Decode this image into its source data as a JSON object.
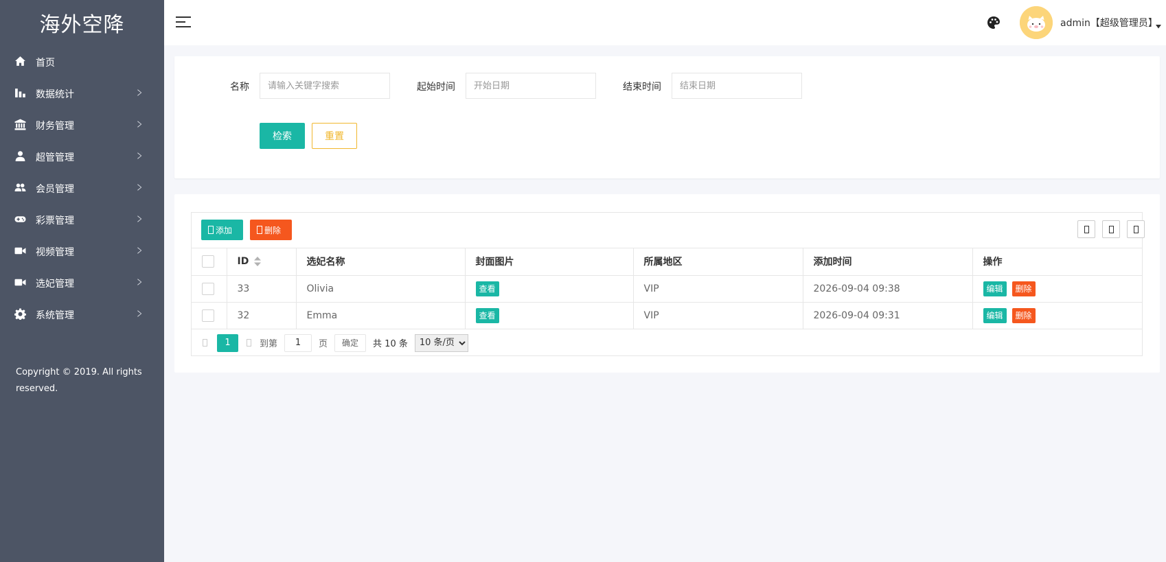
{
  "sidebar": {
    "logo": "海外空降",
    "items": [
      {
        "label": "首页",
        "icon": "home-icon",
        "has_arrow": false
      },
      {
        "label": "数据统计",
        "icon": "bar-chart-icon",
        "has_arrow": true
      },
      {
        "label": "财务管理",
        "icon": "bank-icon",
        "has_arrow": true
      },
      {
        "label": "超管管理",
        "icon": "user-icon",
        "has_arrow": true
      },
      {
        "label": "会员管理",
        "icon": "users-icon",
        "has_arrow": true
      },
      {
        "label": "彩票管理",
        "icon": "gamepad-icon",
        "has_arrow": true
      },
      {
        "label": "视频管理",
        "icon": "video-camera-icon",
        "has_arrow": true
      },
      {
        "label": "选妃管理",
        "icon": "video-camera-icon",
        "has_arrow": true
      },
      {
        "label": "系统管理",
        "icon": "gear-icon",
        "has_arrow": true
      }
    ],
    "copyright": "Copyright © 2019. All rights reserved."
  },
  "header": {
    "user_label": "admin【超级管理员】"
  },
  "search": {
    "name_label": "名称",
    "name_placeholder": "请输入关键字搜索",
    "start_label": "起始时间",
    "start_placeholder": "开始日期",
    "end_label": "结束时间",
    "end_placeholder": "结束日期",
    "search_button": "检索",
    "reset_button": "重置"
  },
  "toolbar": {
    "add_label": "添加",
    "delete_label": "删除"
  },
  "table": {
    "columns": [
      "ID",
      "选妃名称",
      "封面图片",
      "所属地区",
      "添加时间",
      "操作"
    ],
    "rows": [
      {
        "id": "33",
        "name": "Olivia",
        "cover": "查看",
        "region": "VIP",
        "time": "2026-09-04 09:38",
        "edit": "编辑",
        "delete": "删除"
      },
      {
        "id": "32",
        "name": "Emma",
        "cover": "查看",
        "region": "VIP",
        "time": "2026-09-04 09:31",
        "edit": "编辑",
        "delete": "删除"
      }
    ]
  },
  "pager": {
    "current": "1",
    "goto_label": "到第",
    "page_value": "1",
    "page_unit": "页",
    "confirm": "确定",
    "total": "共 10 条",
    "page_size_option": "10 条/页"
  },
  "colors": {
    "sidebar_bg": "#4d5565",
    "accent_teal": "#1ab7a5",
    "danger_red": "#f5571e",
    "warn_yellow": "#f1b72d"
  }
}
